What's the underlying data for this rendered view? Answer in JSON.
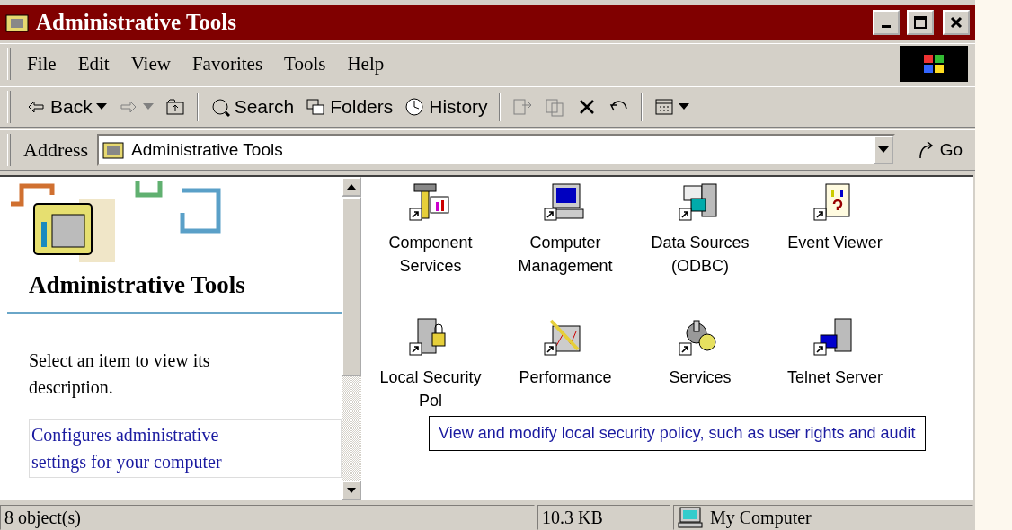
{
  "window": {
    "title": "Administrative Tools"
  },
  "menu": [
    "File",
    "Edit",
    "View",
    "Favorites",
    "Tools",
    "Help"
  ],
  "toolbar": [
    {
      "kind": "text",
      "label": "Back",
      "dropdown": true,
      "disabled": false
    },
    {
      "kind": "icon",
      "dropdown": true,
      "disabled": true
    },
    {
      "kind": "icon",
      "dropdown": false,
      "disabled": false
    },
    {
      "kind": "sep"
    },
    {
      "kind": "text",
      "label": "Search",
      "dropdown": false,
      "disabled": false
    },
    {
      "kind": "text",
      "label": "Folders",
      "dropdown": false,
      "disabled": false
    },
    {
      "kind": "text",
      "label": "History",
      "dropdown": false,
      "disabled": false
    },
    {
      "kind": "sep"
    },
    {
      "kind": "icon",
      "dropdown": false,
      "disabled": true
    },
    {
      "kind": "icon",
      "dropdown": false,
      "disabled": true
    },
    {
      "kind": "icon",
      "dropdown": false,
      "disabled": false
    },
    {
      "kind": "icon",
      "dropdown": false,
      "disabled": false
    },
    {
      "kind": "sep"
    },
    {
      "kind": "icon",
      "dropdown": true,
      "disabled": false
    }
  ],
  "address": {
    "label": "Address",
    "value": "Administrative Tools",
    "go": "Go"
  },
  "info_pane": {
    "heading": "Administrative Tools",
    "description": "Select an item to view its description.",
    "link": "Configures administrative settings for your computer"
  },
  "items": [
    {
      "label": "Component Services"
    },
    {
      "label": "Computer Management"
    },
    {
      "label": "Data Sources (ODBC)"
    },
    {
      "label": "Event Viewer"
    },
    {
      "label": "Local Security Pol"
    },
    {
      "label": "Performance"
    },
    {
      "label": "Services"
    },
    {
      "label": "Telnet Server"
    }
  ],
  "tooltip": "View and modify local security policy, such as user rights and audit",
  "status_bar": {
    "objects": "8 object(s)",
    "size": "10.3 KB",
    "zone": "My Computer"
  }
}
